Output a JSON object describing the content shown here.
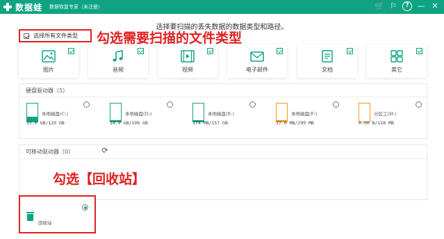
{
  "titlebar": {
    "app_name": "数据蛙",
    "subtitle": "数据恢复专家（未注册）",
    "icons": [
      "cart-icon",
      "gift-icon",
      "help-icon",
      "minimize-icon",
      "close-icon"
    ],
    "help_glyph": "?",
    "minimize_glyph": "—",
    "close_glyph": "✕",
    "cart_glyph": "🛒",
    "gift_glyph": "⚐"
  },
  "instruction": "选择要扫描的丢失数据的数据类型和路径。",
  "select_all": {
    "label": "选择所有文件类型",
    "checked": true
  },
  "annotation_1": "勾选需要扫描的文件类型",
  "file_types": [
    {
      "label": "图片",
      "icon": "image-icon",
      "checked": true
    },
    {
      "label": "音频",
      "icon": "audio-icon",
      "checked": true
    },
    {
      "label": "视频",
      "icon": "video-icon",
      "checked": true
    },
    {
      "label": "电子邮件",
      "icon": "email-icon",
      "checked": true
    },
    {
      "label": "文档",
      "icon": "document-icon",
      "checked": true
    },
    {
      "label": "其它",
      "icon": "other-icon",
      "checked": true
    }
  ],
  "hard_drives": {
    "title": "硬盘驱动器（5）",
    "items": [
      {
        "name": "本地磁盘(C:)",
        "size": "33.0 GB/120 GB",
        "color": "#0fa383",
        "fill": 0.275
      },
      {
        "name": "本地磁盘(D:)",
        "size": "14.9 GB/199 GB",
        "color": "#0fa383",
        "fill": 0.075
      },
      {
        "name": "本地磁盘(E:)",
        "size": "174 MB/157 GB",
        "color": "#0fa383",
        "fill": 0.01
      },
      {
        "name": "本地磁盘(F:)",
        "size": "27.0 MB/299 MB",
        "color": "#f19a1a",
        "fill": 0.09
      },
      {
        "name": "分区工(H:)",
        "size": "0.00  B/128 MB",
        "color": "#f19a1a",
        "fill": 0.0
      }
    ]
  },
  "removable": {
    "title": "可移动驱动器（0）",
    "refresh_glyph": "⟳"
  },
  "annotation_2": "勾选【回收站】",
  "recycle_bin": {
    "label": "回收站",
    "selected": true
  }
}
